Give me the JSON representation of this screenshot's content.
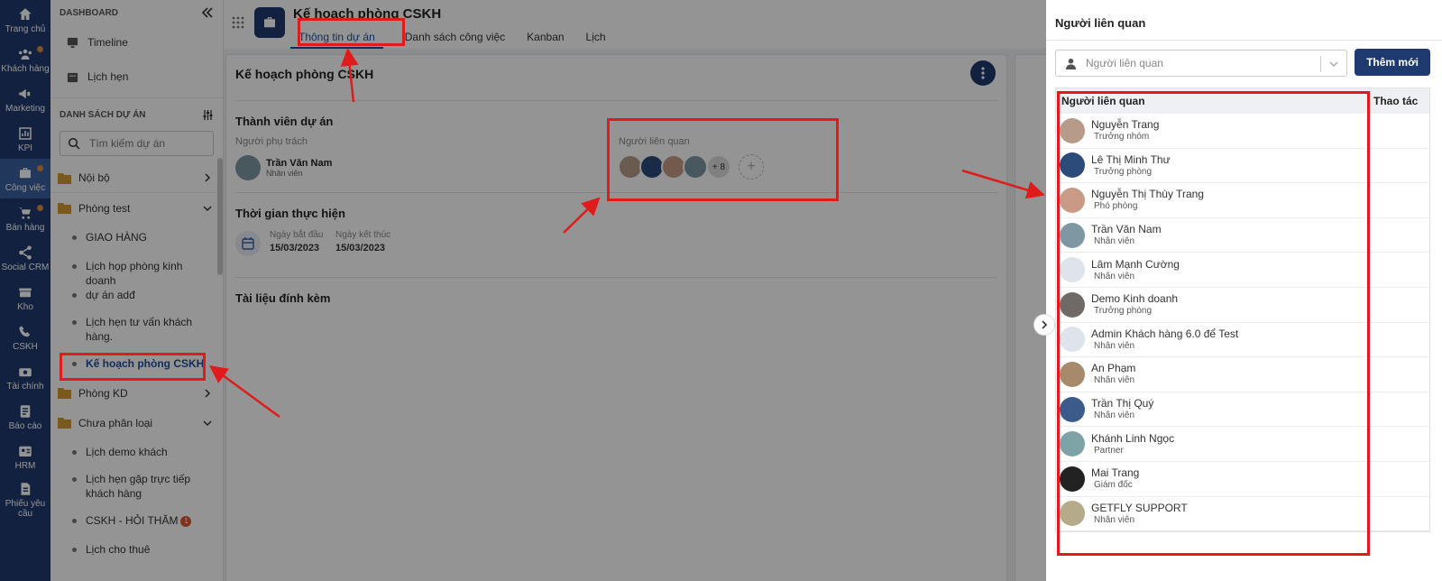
{
  "nav": [
    {
      "label": "Trang chủ",
      "icon": "home-icon",
      "dot": false
    },
    {
      "label": "Khách hàng",
      "icon": "customers-icon",
      "dot": true
    },
    {
      "label": "Marketing",
      "icon": "megaphone-icon",
      "dot": false
    },
    {
      "label": "KPI",
      "icon": "kpi-icon",
      "dot": false
    },
    {
      "label": "Công việc",
      "icon": "briefcase-icon",
      "dot": true
    },
    {
      "label": "Bán hàng",
      "icon": "cart-icon",
      "dot": true
    },
    {
      "label": "Social CRM",
      "icon": "share-icon",
      "dot": false
    },
    {
      "label": "Kho",
      "icon": "warehouse-icon",
      "dot": false
    },
    {
      "label": "CSKH",
      "icon": "phone-icon",
      "dot": false
    },
    {
      "label": "Tài chính",
      "icon": "finance-icon",
      "dot": false
    },
    {
      "label": "Báo cáo",
      "icon": "report-icon",
      "dot": false
    },
    {
      "label": "HRM",
      "icon": "hrm-icon",
      "dot": false
    },
    {
      "label": "Phiếu yêu cầu",
      "icon": "request-icon",
      "dot": false
    }
  ],
  "sidebar": {
    "dashboard_label": "DASHBOARD",
    "timeline": "Timeline",
    "appointments": "Lịch hẹn",
    "projects_label": "DANH SÁCH DỰ ÁN",
    "search_placeholder": "Tìm kiếm dự án",
    "groups": {
      "noibo": "Nội bộ",
      "phongtest": "Phòng test",
      "phongkd": "Phòng KD",
      "chuaphanloai": "Chưa phân loại"
    },
    "test_items": [
      "GIAO HÀNG",
      "Lịch họp phòng kinh doanh",
      "dự án adđ",
      "Lịch hẹn tư vấn khách hàng.",
      "Kế hoạch phòng CSKH"
    ],
    "unsorted_items": [
      "Lịch demo khách",
      "Lịch hẹn gặp trực tiếp khách hàng",
      "CSKH - HỎI THĂM",
      "Lịch cho thuê"
    ],
    "unsorted_badge": "1"
  },
  "header": {
    "title": "Kế hoạch phòng CSKH",
    "tabs": [
      "Thông tin dự án",
      "Danh sách công việc",
      "Kanban",
      "Lịch"
    ]
  },
  "project": {
    "title": "Kế hoạch phòng CSKH",
    "members_heading": "Thành viên dự án",
    "owner_label": "Người phụ trách",
    "owner_name": "Trần Văn Nam",
    "owner_role": "Nhân viên",
    "related_label": "Người liên quan",
    "related_more": "+ 8",
    "time_heading": "Thời gian thực hiện",
    "start_label": "Ngày bắt đầu",
    "start_date": "15/03/2023",
    "end_label": "Ngày kết thúc",
    "end_date": "15/03/2023",
    "attachments_heading": "Tài liệu đính kèm"
  },
  "panel": {
    "title": "Người liên quan",
    "select_placeholder": "Người liên quan",
    "add_button": "Thêm mới",
    "col_person": "Người liên quan",
    "col_action": "Thao tác",
    "people": [
      {
        "name": "Nguyễn Trang",
        "role": "Trưởng nhóm",
        "color": "#b79b8a"
      },
      {
        "name": "Lê Thị Minh Thư",
        "role": "Trưởng phòng",
        "color": "#2c4a7a"
      },
      {
        "name": "Nguyễn Thị Thùy Trang",
        "role": "Phó phòng",
        "color": "#c99a86"
      },
      {
        "name": "Trần Văn Nam",
        "role": "Nhân viên",
        "color": "#7f97a3"
      },
      {
        "name": "Lâm Mạnh Cường",
        "role": "Nhân viên",
        "color": "#dfe3ec"
      },
      {
        "name": "Demo Kinh doanh",
        "role": "Trưởng phòng",
        "color": "#6f6a66"
      },
      {
        "name": "Admin Khách hàng 6.0 để Test",
        "role": "Nhân viên",
        "color": "#dfe3ec"
      },
      {
        "name": "An Phạm",
        "role": "Nhân viên",
        "color": "#a7896b"
      },
      {
        "name": "Trần Thị Quý",
        "role": "Nhân viên",
        "color": "#3c5a8a"
      },
      {
        "name": "Khánh Linh Ngọc",
        "role": "Partner",
        "color": "#7ea3a6"
      },
      {
        "name": "Mai Trang",
        "role": "Giám đốc",
        "color": "#222222"
      },
      {
        "name": "GETFLY SUPPORT",
        "role": "Nhân viên",
        "color": "#b5ab8a"
      }
    ]
  },
  "colors": {
    "primary": "#1f3a6e",
    "annotation": "#e01b1b"
  }
}
